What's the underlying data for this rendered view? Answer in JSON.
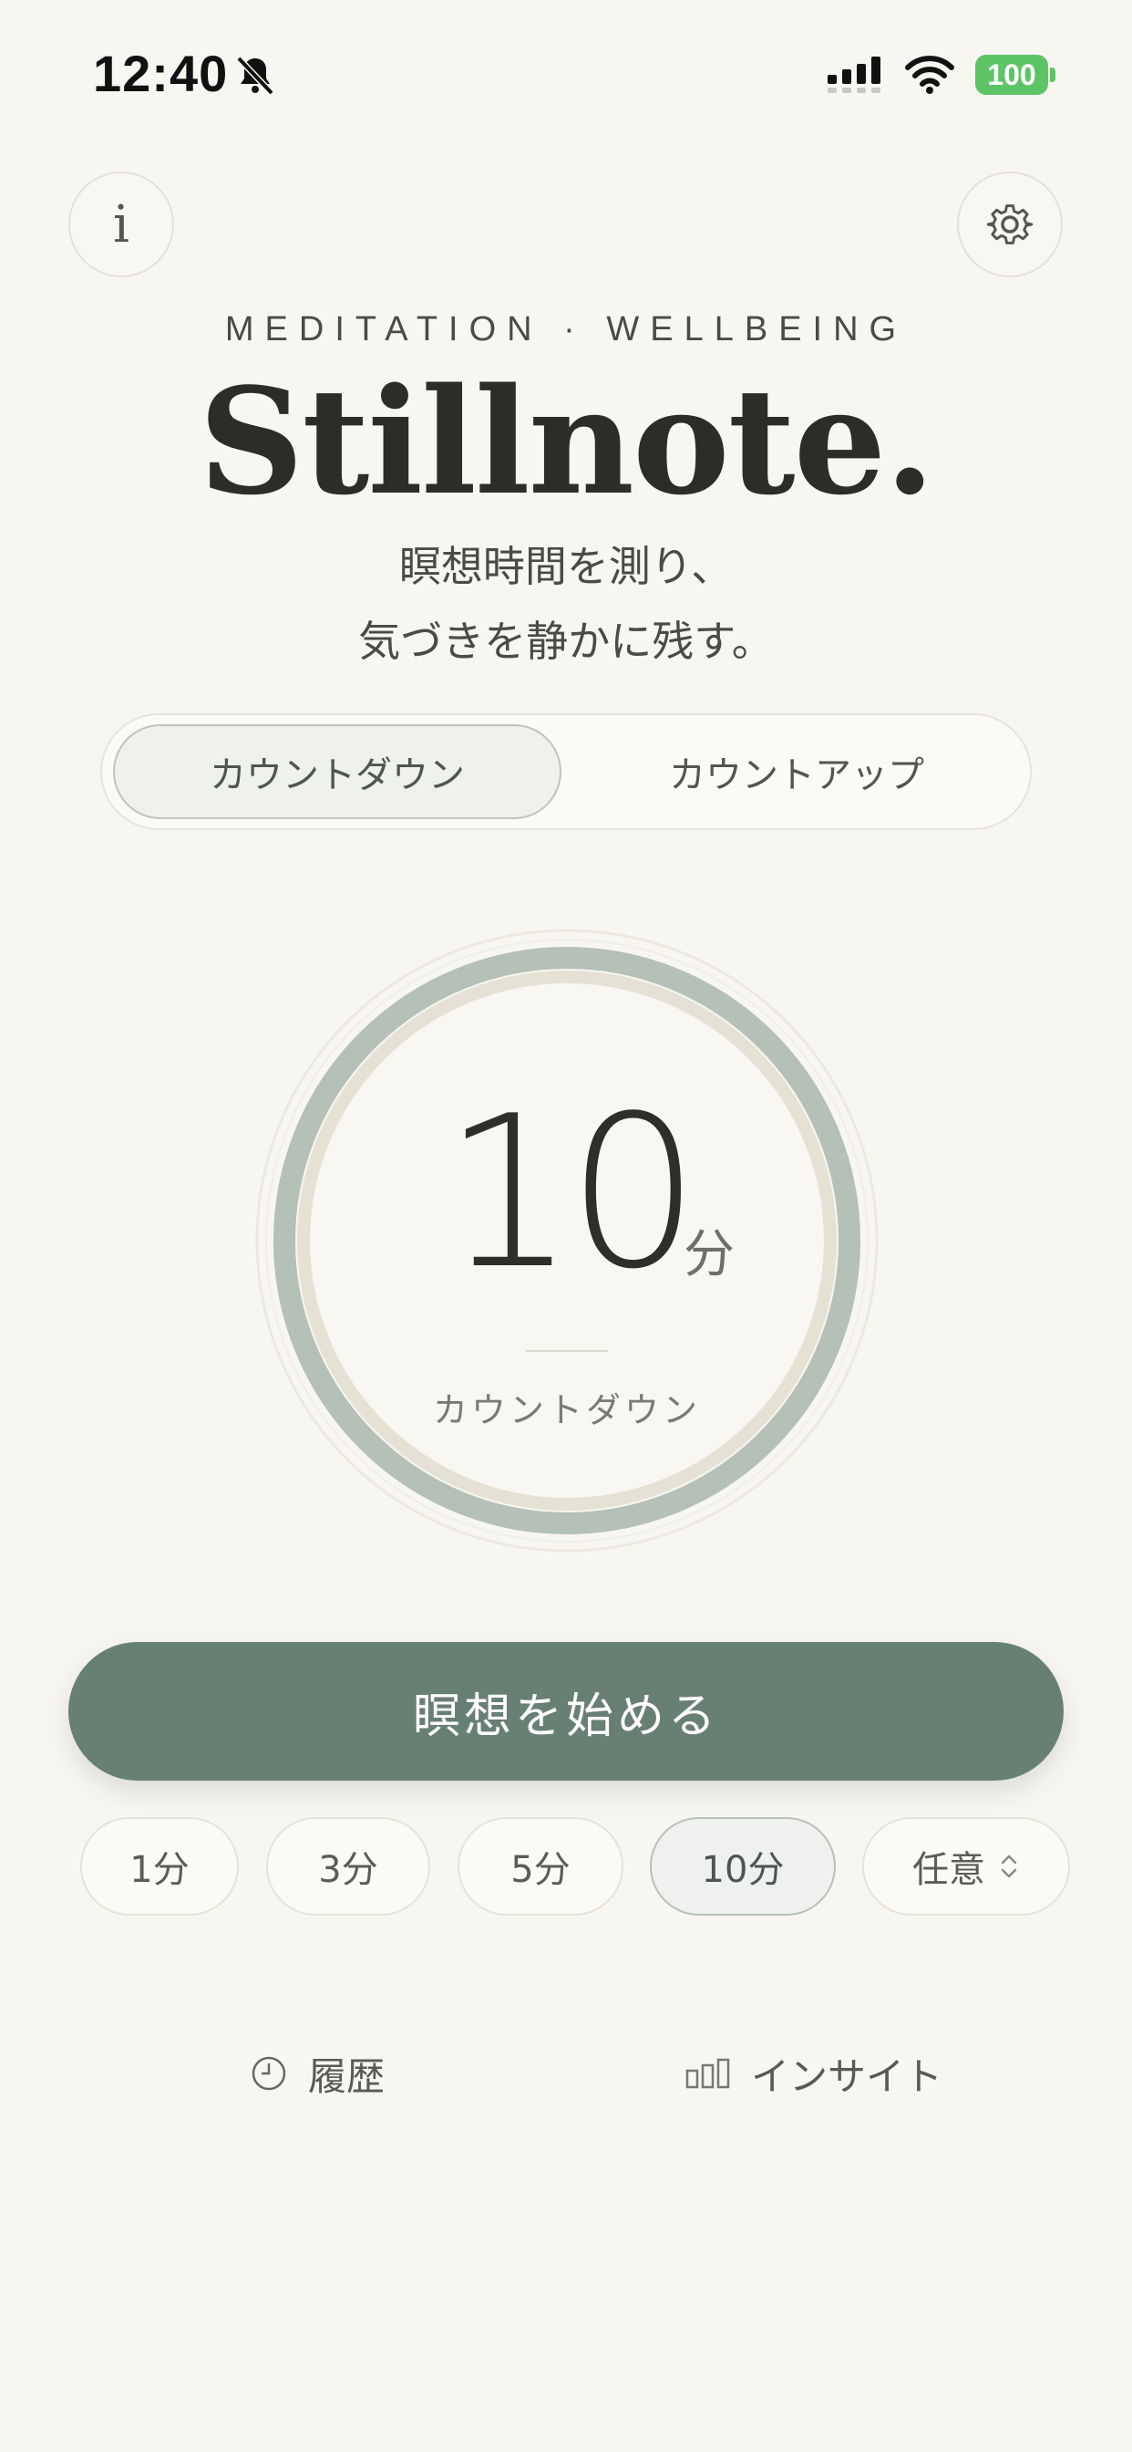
{
  "status_bar": {
    "time": "12:40",
    "battery": "100",
    "icons": [
      "bell-slash-icon",
      "signal-icon",
      "wifi-icon",
      "battery-icon"
    ]
  },
  "header": {
    "info_glyph": "i",
    "eyebrow": "MEDITATION · WELLBEING",
    "title": "Stillnote.",
    "subtitle_line1": "瞑想時間を測り、",
    "subtitle_line2": "気づきを静かに残す。"
  },
  "mode_toggle": {
    "options": [
      {
        "label": "カウントダウン",
        "selected": true
      },
      {
        "label": "カウントアップ",
        "selected": false
      }
    ]
  },
  "timer": {
    "value": "10",
    "unit": "分",
    "mode_label": "カウントダウン"
  },
  "start_button": {
    "label": "瞑想を始める"
  },
  "presets": [
    {
      "label": "1分",
      "selected": false
    },
    {
      "label": "3分",
      "selected": false
    },
    {
      "label": "5分",
      "selected": false
    },
    {
      "label": "10分",
      "selected": true
    },
    {
      "label": "任意",
      "selected": false
    }
  ],
  "bottom_nav": {
    "history": "履歴",
    "insight": "インサイト"
  },
  "colors": {
    "background": "#f8f6f0",
    "accent": "#687f74",
    "ring": "#b5c0b6",
    "ring_track": "#e5e1d4"
  }
}
